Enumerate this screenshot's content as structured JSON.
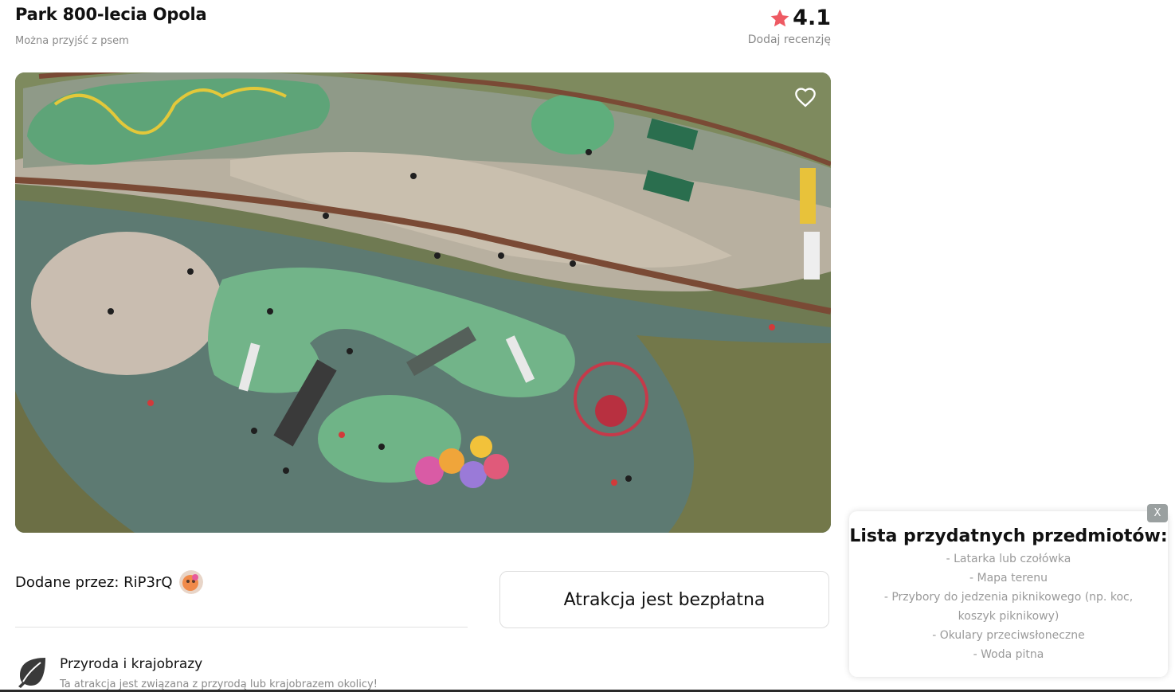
{
  "attraction": {
    "title": "Park 800-lecia Opola",
    "subtitle": "Można przyjść z psem",
    "rating": "4.1",
    "add_review": "Dodaj recenzję"
  },
  "photo": {
    "icon": "heart-icon"
  },
  "added_by": {
    "label": "Dodane przez: RiP3rQ"
  },
  "price": {
    "label": "Atrakcja jest bezpłatna"
  },
  "category": {
    "icon": "leaf-icon",
    "title": "Przyroda i krajobrazy",
    "description": "Ta atrakcja jest związana z przyrodą lub krajobrazem okolicy!"
  },
  "useful_items": {
    "title": "Lista przydatnych przedmiotów:",
    "close_label": "X",
    "items": [
      "- Latarka lub czołówka",
      "- Mapa terenu",
      "- Przybory do jedzenia piknikowego (np. koc, koszyk piknikowy)",
      "- Okulary przeciwsłoneczne",
      "- Woda pitna"
    ]
  },
  "colors": {
    "star": "#ee5a63",
    "grass": "#6e7b55",
    "rubber_green": "#77b486"
  }
}
